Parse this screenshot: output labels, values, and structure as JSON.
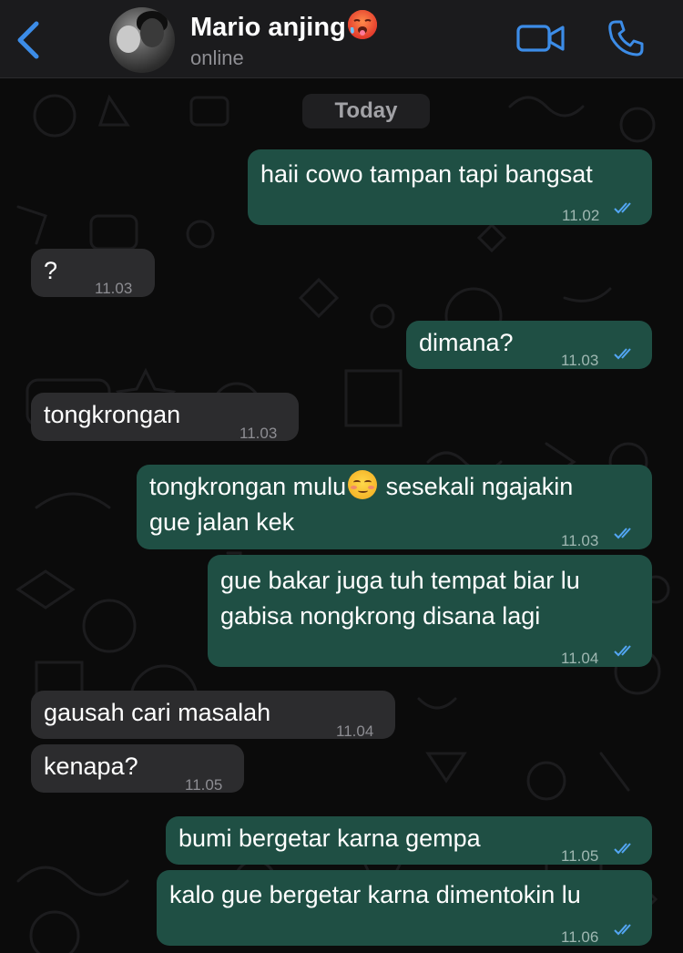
{
  "header": {
    "contact_name": "Mario anjing",
    "status": "online",
    "name_emoji": "hot-face-emoji"
  },
  "chat": {
    "date_label": "Today",
    "messages": [
      {
        "dir": "out",
        "text": "haii cowo tampan tapi bangsat",
        "time": "11.02",
        "read": true
      },
      {
        "dir": "in",
        "text": "?",
        "time": "11.03"
      },
      {
        "dir": "out",
        "text": "dimana?",
        "time": "11.03",
        "read": true
      },
      {
        "dir": "in",
        "text": "tongkrongan",
        "time": "11.03"
      },
      {
        "dir": "out",
        "text_line1_a": "tongkrongan mulu",
        "text_line1_b": " sesekali ngajakin",
        "text_line2": "gue jalan kek",
        "time": "11.03",
        "read": true
      },
      {
        "dir": "out",
        "text_line1": "gue bakar juga tuh tempat biar lu",
        "text_line2": "gabisa nongkrong disana lagi",
        "time": "11.04",
        "read": true
      },
      {
        "dir": "in",
        "text": "gausah cari masalah",
        "time": "11.04"
      },
      {
        "dir": "in",
        "text": "kenapa?",
        "time": "11.05"
      },
      {
        "dir": "out",
        "text": "bumi bergetar karna gempa",
        "time": "11.05",
        "read": true
      },
      {
        "dir": "out",
        "text": "kalo gue bergetar karna dimentokin lu",
        "time": "11.06",
        "read": true
      }
    ]
  },
  "icons": {
    "back": "chevron-left-icon",
    "video": "video-camera-icon",
    "call": "phone-icon",
    "read_receipt": "double-check-icon"
  },
  "colors": {
    "accent": "#3c8ce7",
    "outgoing_bubble": "#1f4f44",
    "incoming_bubble": "#2c2c2e",
    "header_bg": "#1b1b1d",
    "read_tick": "#53a6f4"
  }
}
